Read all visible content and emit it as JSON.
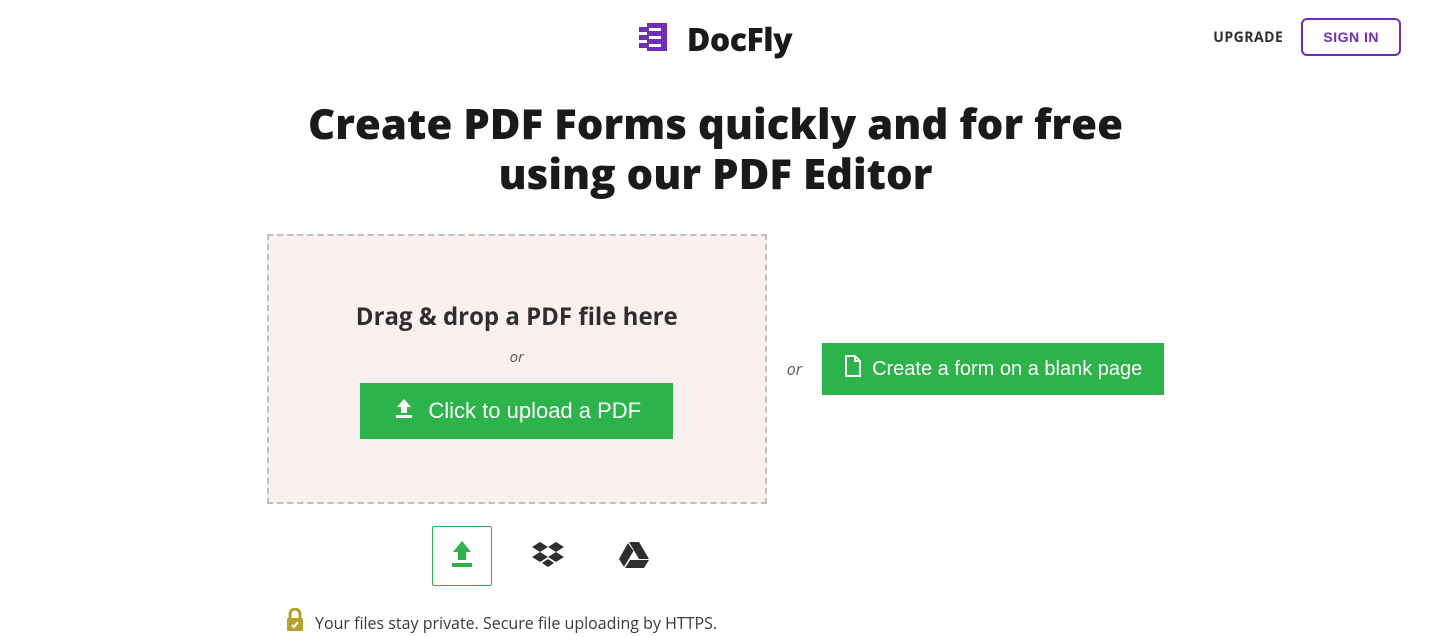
{
  "header": {
    "brand": "DocFly",
    "upgrade": "UPGRADE",
    "signin": "SIGN IN"
  },
  "hero": {
    "title_line1": "Create PDF Forms quickly and for free",
    "title_line2": "using our PDF Editor"
  },
  "dropzone": {
    "title": "Drag & drop a PDF file here",
    "or": "or",
    "upload_label": "Click to upload a PDF"
  },
  "middle_or": "or",
  "blank_button": "Create a form on a blank page",
  "sources": {
    "upload_icon": "upload-icon",
    "dropbox_icon": "dropbox-icon",
    "gdrive_icon": "google-drive-icon"
  },
  "privacy": {
    "text": "Your files stay private. Secure file uploading by HTTPS."
  },
  "colors": {
    "brand_purple": "#6f2dbd",
    "action_green": "#2cb34a",
    "lock_olive": "#b5a22e"
  }
}
